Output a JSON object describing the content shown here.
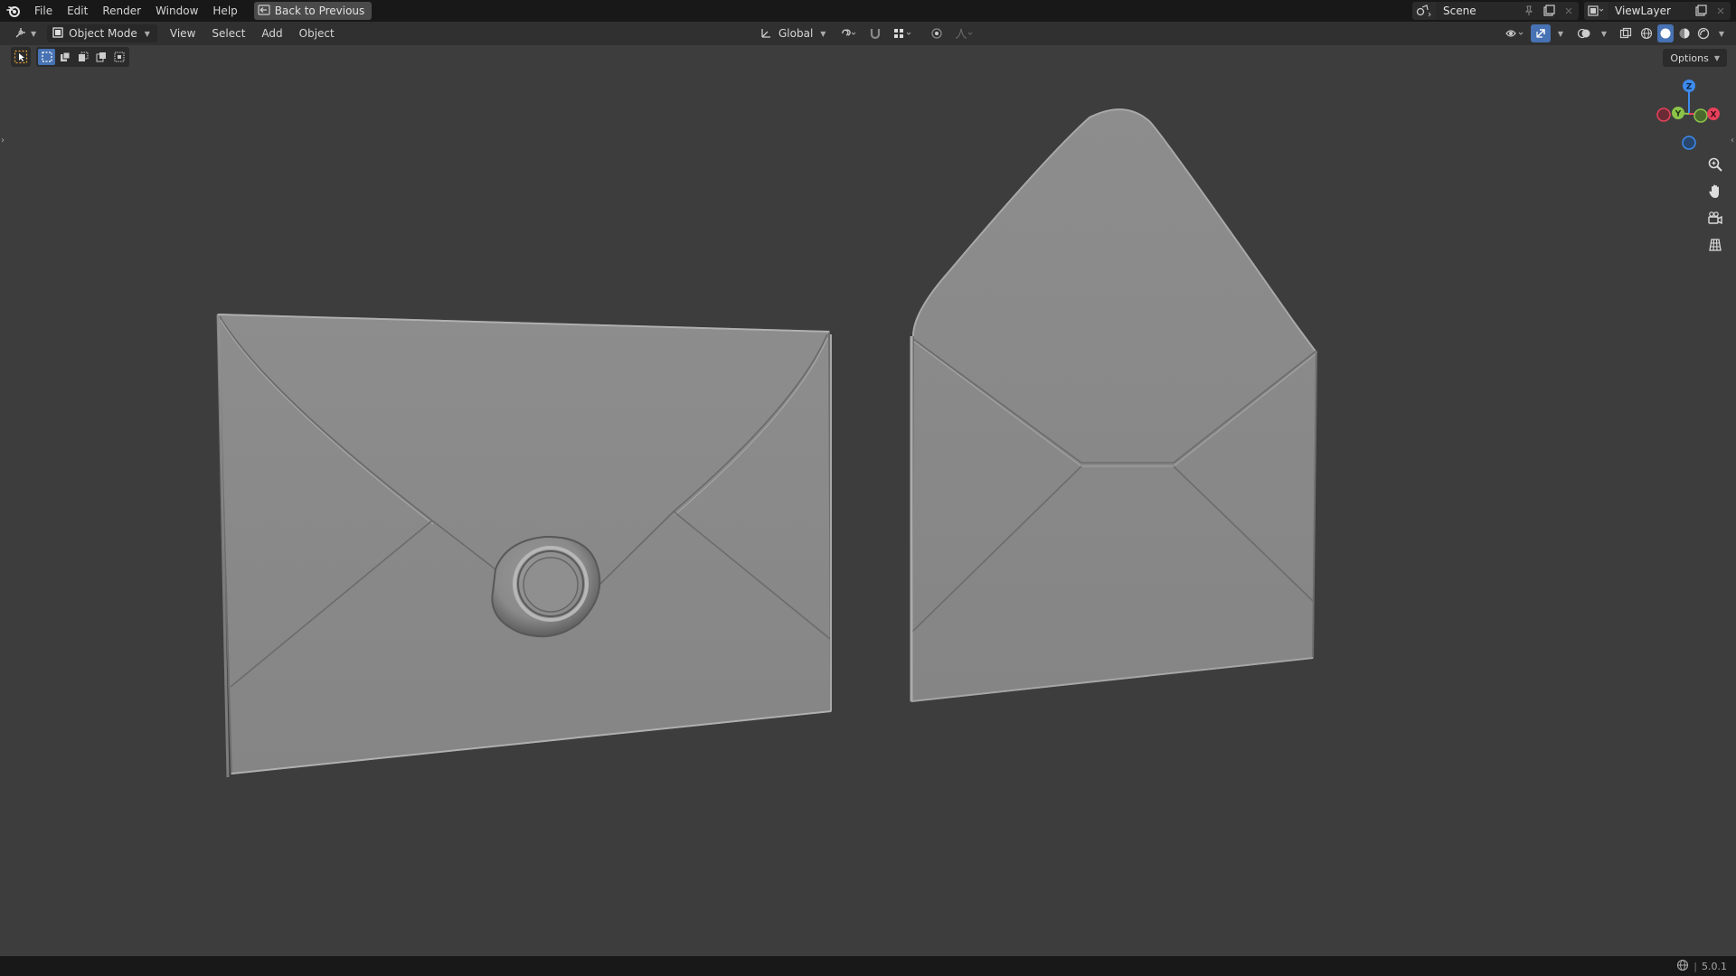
{
  "menu": {
    "items": [
      {
        "id": "file",
        "label": "File"
      },
      {
        "id": "edit",
        "label": "Edit"
      },
      {
        "id": "render",
        "label": "Render"
      },
      {
        "id": "window",
        "label": "Window"
      },
      {
        "id": "help",
        "label": "Help"
      }
    ],
    "back_label": "Back to Previous"
  },
  "scene": {
    "name": "Scene"
  },
  "view_layer": {
    "name": "ViewLayer"
  },
  "header": {
    "mode_label": "Object Mode",
    "menus": [
      "View",
      "Select",
      "Add",
      "Object"
    ],
    "transform_orientation": "Global"
  },
  "options_label": "Options",
  "gizmo": {
    "x": "X",
    "y": "Y",
    "z": "Z"
  },
  "status": {
    "version": "5.0.1"
  },
  "colors": {
    "accent": "#4772b3",
    "axis_x": "#e8415b",
    "axis_y": "#8bc34a",
    "axis_z": "#3d8bef",
    "viewport_bg": "#3d3d3d"
  },
  "icons": {
    "logo": "blender-logo-icon",
    "zoom": "zoom-icon",
    "pan": "hand-icon",
    "camera": "camera-icon",
    "ortho": "grid-icon"
  }
}
